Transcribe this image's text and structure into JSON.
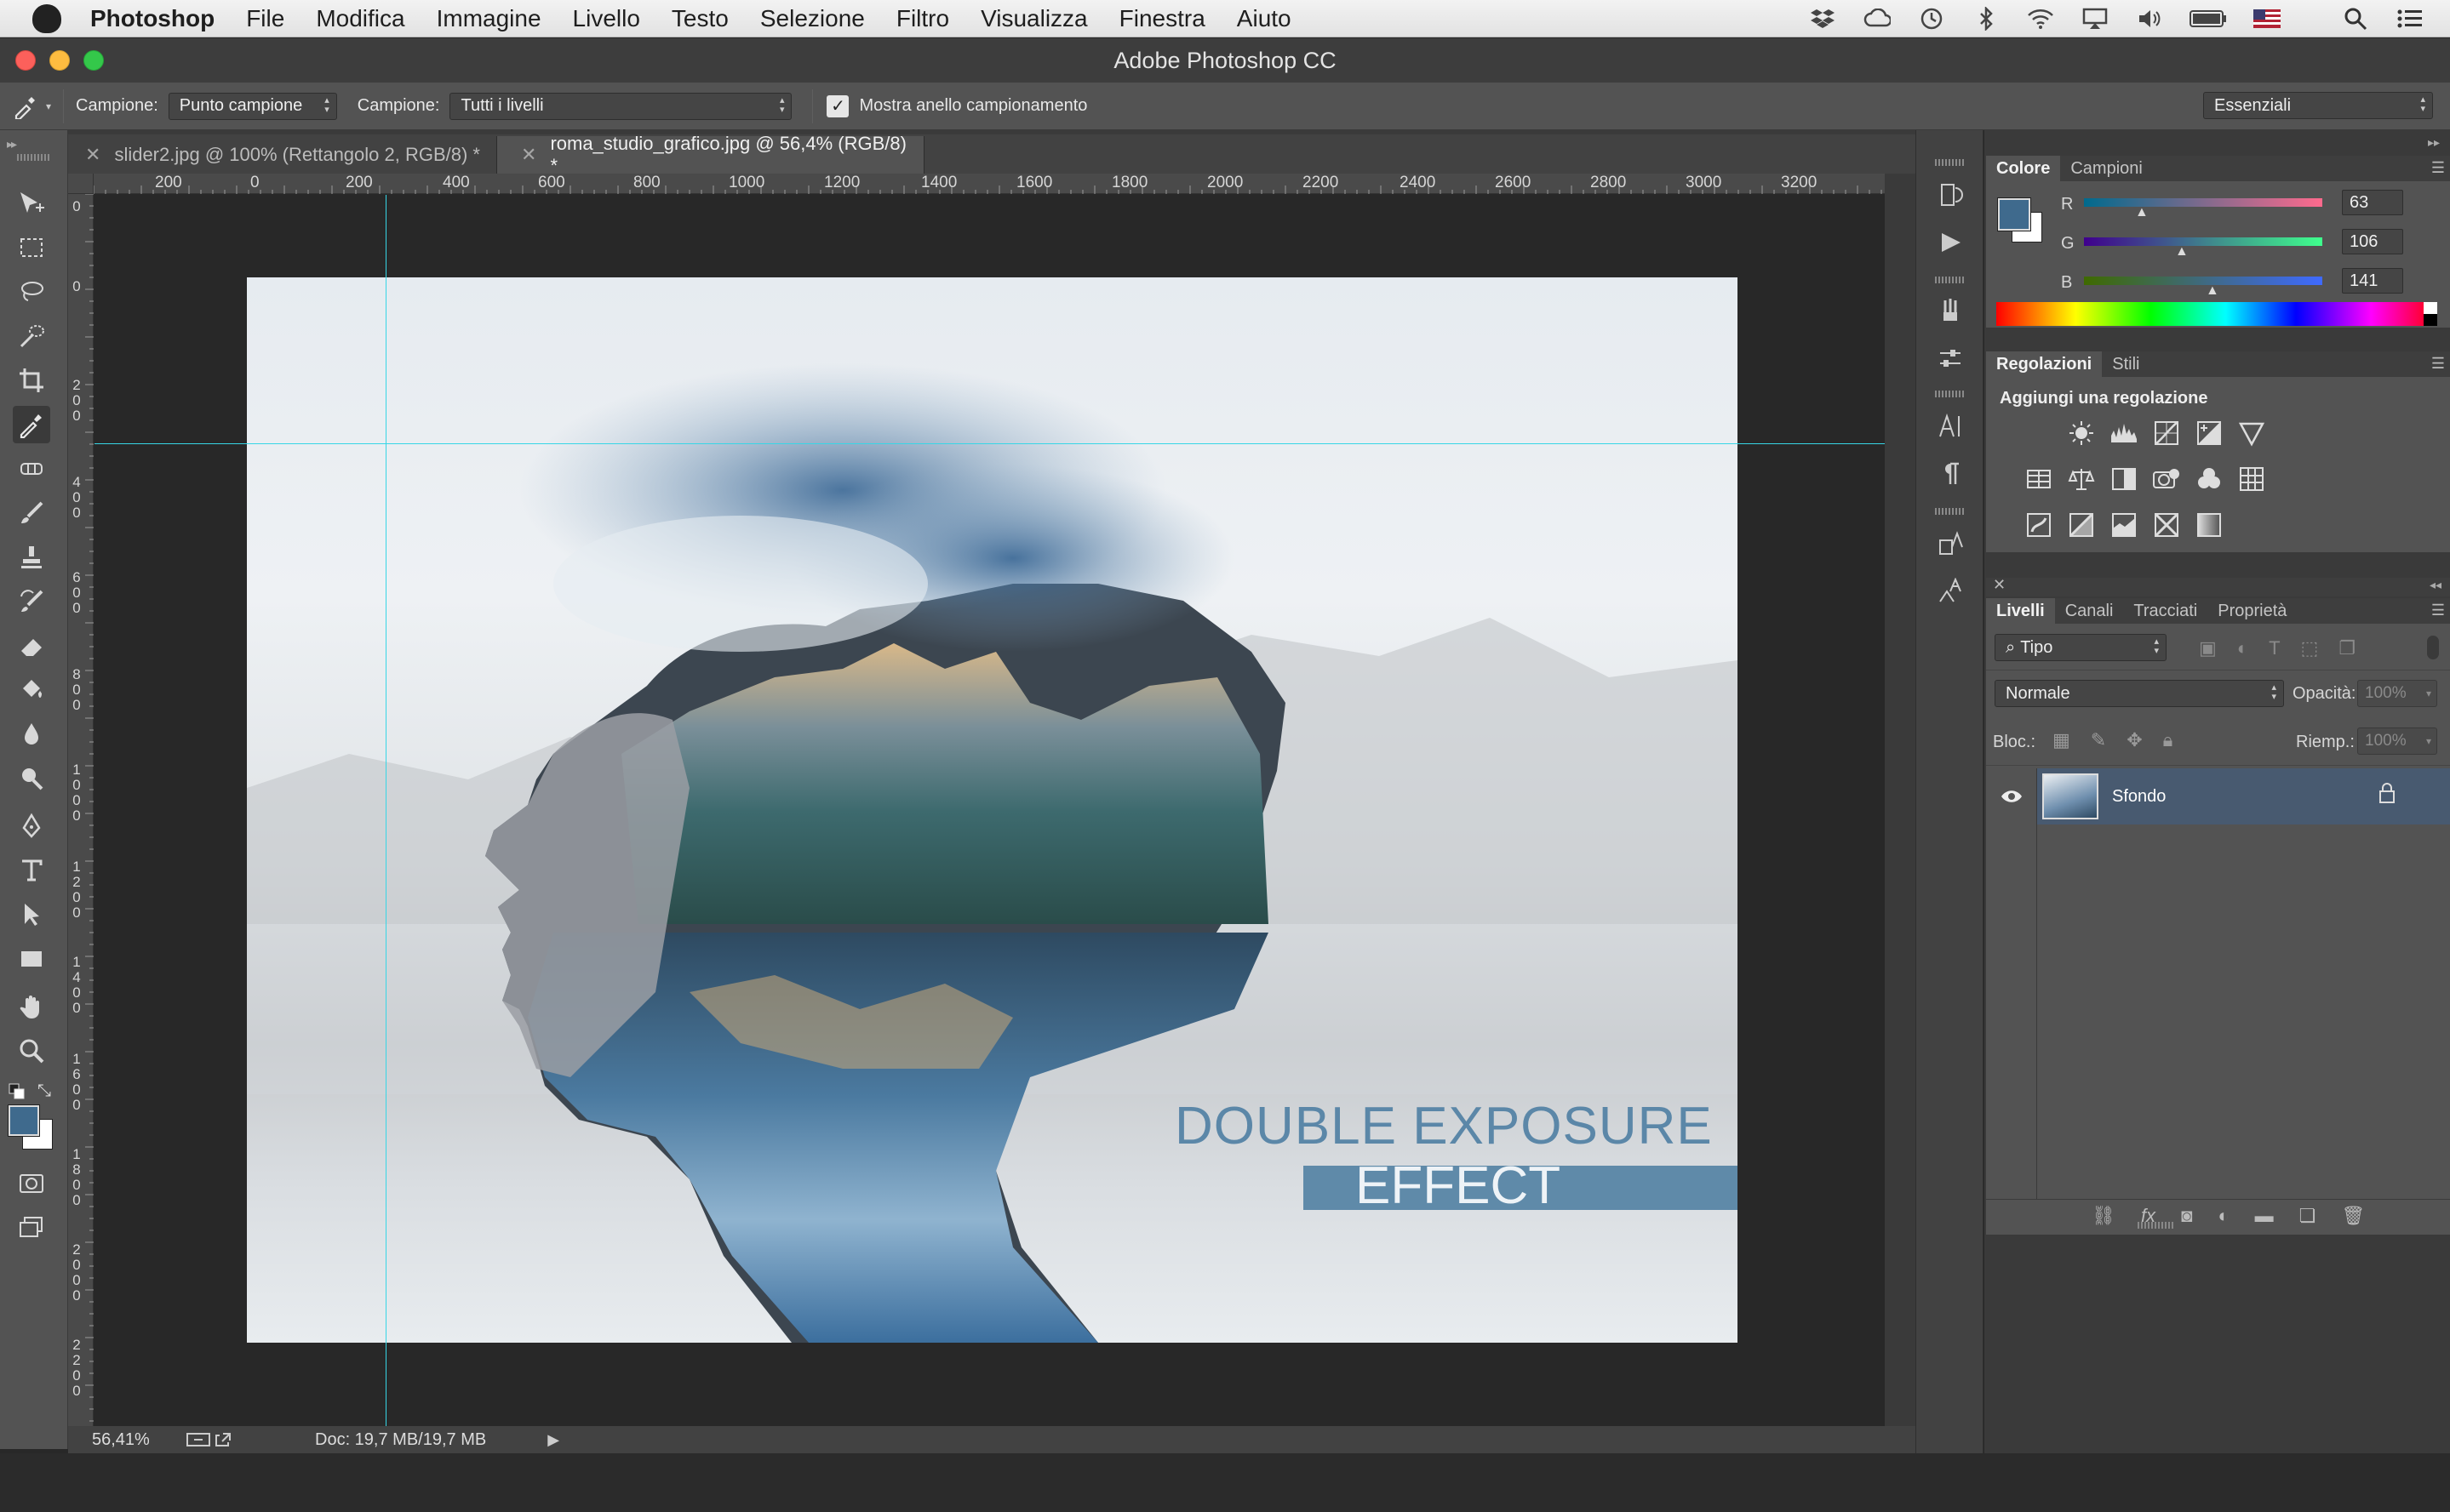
{
  "menubar": {
    "app_name": "Photoshop",
    "items": [
      "File",
      "Modifica",
      "Immagine",
      "Livello",
      "Testo",
      "Selezione",
      "Filtro",
      "Visualizza",
      "Finestra",
      "Aiuto"
    ]
  },
  "window": {
    "title": "Adobe Photoshop CC"
  },
  "options_bar": {
    "sample_size_label": "Campione:",
    "sample_size_value": "Punto campione",
    "sample_layers_label": "Campione:",
    "sample_layers_value": "Tutti i livelli",
    "show_ring_label": "Mostra anello campionamento",
    "show_ring_checked": true,
    "workspace_value": "Essenziali"
  },
  "document_tabs": [
    {
      "label": "slider2.jpg @ 100% (Rettangolo 2, RGB/8) *",
      "active": false
    },
    {
      "label": "roma_studio_grafico.jpg @ 56,4% (RGB/8) *",
      "active": true
    }
  ],
  "rulers": {
    "horizontal": [
      "200",
      "0",
      "200",
      "400",
      "600",
      "800",
      "1000",
      "1200",
      "1400",
      "1600",
      "1800",
      "2000",
      "2200",
      "2400",
      "2600",
      "2800",
      "3000",
      "3200"
    ],
    "vertical": [
      "0",
      "0",
      "200",
      "400",
      "600",
      "800",
      "1000",
      "1200",
      "1400",
      "1600",
      "1800",
      "2000",
      "2200"
    ]
  },
  "canvas": {
    "headline": "DOUBLE EXPOSURE",
    "subheadline": "EFFECT",
    "accent_color": "#5b87a8",
    "banner_color": "#5f8aa9"
  },
  "status_bar": {
    "zoom": "56,41%",
    "doc_size": "Doc: 19,7 MB/19,7 MB"
  },
  "color_panel": {
    "tabs": [
      "Colore",
      "Campioni"
    ],
    "channels": [
      {
        "label": "R",
        "value": "63"
      },
      {
        "label": "G",
        "value": "106"
      },
      {
        "label": "B",
        "value": "141"
      }
    ],
    "foreground_color": "#3f6a8d",
    "background_color": "#ffffff"
  },
  "adjustments_panel": {
    "tabs": [
      "Regolazioni",
      "Stili"
    ],
    "heading": "Aggiungi una regolazione"
  },
  "layers_panel": {
    "tabs": [
      "Livelli",
      "Canali",
      "Tracciati",
      "Proprietà"
    ],
    "filter_placeholder": "Tipo",
    "blend_mode": "Normale",
    "opacity_label": "Opacità:",
    "opacity_value": "100%",
    "lock_label": "Bloc.:",
    "fill_label": "Riemp.:",
    "fill_value": "100%",
    "layers": [
      {
        "name": "Sfondo",
        "visible": true,
        "locked": true,
        "selected": true
      }
    ]
  }
}
